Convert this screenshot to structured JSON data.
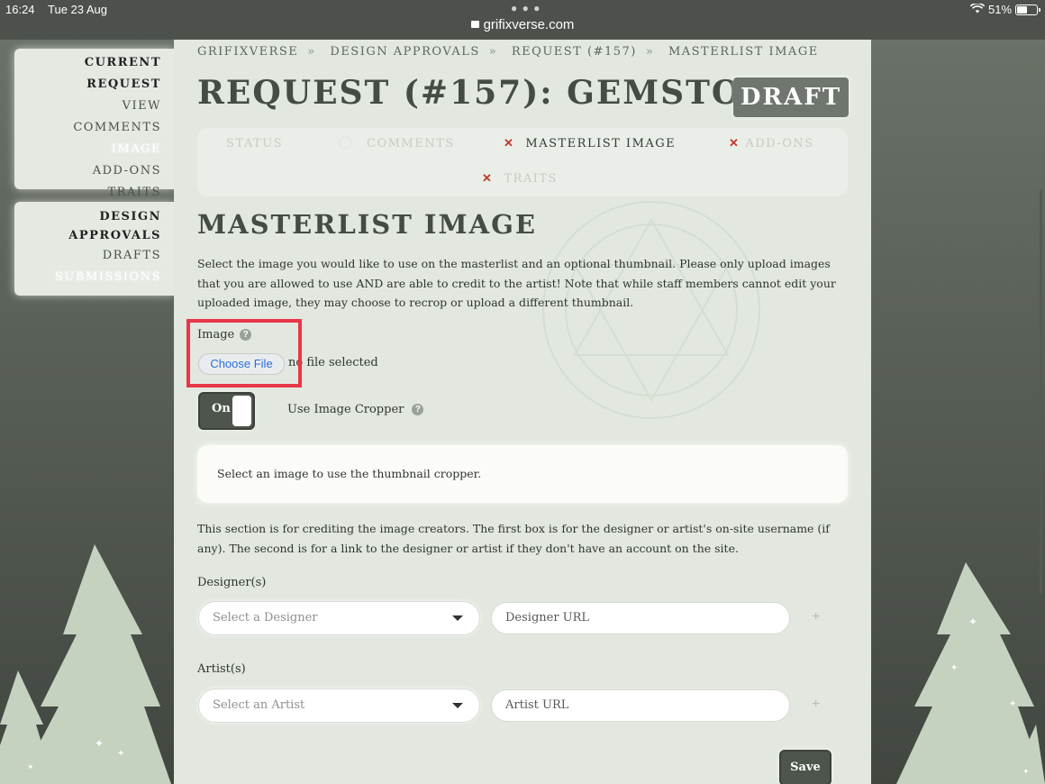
{
  "status_bar": {
    "time": "16:24",
    "date": "Tue 23 Aug",
    "url": "grifixverse.com",
    "battery": "51%"
  },
  "sidebar": {
    "current_request": {
      "heading": "CURRENT REQUEST",
      "items": [
        {
          "label": "VIEW",
          "active": false
        },
        {
          "label": "COMMENTS",
          "active": false
        },
        {
          "label": "IMAGE",
          "active": true
        },
        {
          "label": "ADD-ONS",
          "active": false
        },
        {
          "label": "TRAITS",
          "active": false
        }
      ]
    },
    "design_approvals": {
      "heading_line1": "DESIGN",
      "heading_line2": "APPROVALS",
      "items": [
        {
          "label": "DRAFTS",
          "active": false
        },
        {
          "label": "SUBMISSIONS",
          "active": true
        }
      ]
    }
  },
  "breadcrumb": [
    "GRIFIXVERSE",
    "DESIGN APPROVALS",
    "REQUEST (#157)",
    "MASTERLIST IMAGE"
  ],
  "breadcrumb_sep": "»",
  "page_title": "REQUEST (#157): GEMSTONE",
  "draft_badge": "DRAFT",
  "tabs": {
    "status": "STATUS",
    "comments": "COMMENTS",
    "masterlist": "MASTERLIST IMAGE",
    "addons": "ADD-ONS",
    "traits": "TRAITS",
    "x_mark": "✕"
  },
  "section_title": "MASTERLIST IMAGE",
  "description": "Select the image you would like to use on the masterlist and an optional thumbnail. Please only upload images that you are allowed to use AND are able to credit to the artist! Note that while staff members cannot edit your uploaded image, they may choose to recrop or upload a different thumbnail.",
  "image_field": {
    "label": "Image",
    "help": "?",
    "button": "Choose File",
    "status": "no file selected"
  },
  "cropper_toggle": {
    "state": "On",
    "label": "Use Image Cropper",
    "help": "?"
  },
  "cropper_message": "Select an image to use the thumbnail cropper.",
  "credit_description": "This section is for crediting the image creators. The first box is for the designer or artist's on-site username (if any). The second is for a link to the designer or artist if they don't have an account on the site.",
  "designers": {
    "label": "Designer(s)",
    "select_placeholder": "Select a Designer",
    "url_placeholder": "Designer URL",
    "add": "+"
  },
  "artists": {
    "label": "Artist(s)",
    "select_placeholder": "Select an Artist",
    "url_placeholder": "Artist URL",
    "add": "+"
  },
  "save_button": "Save",
  "colors": {
    "accent": "#4e554d",
    "highlight": "#e8364a",
    "error_x": "#c0392b",
    "panel": "#e2e8df"
  }
}
